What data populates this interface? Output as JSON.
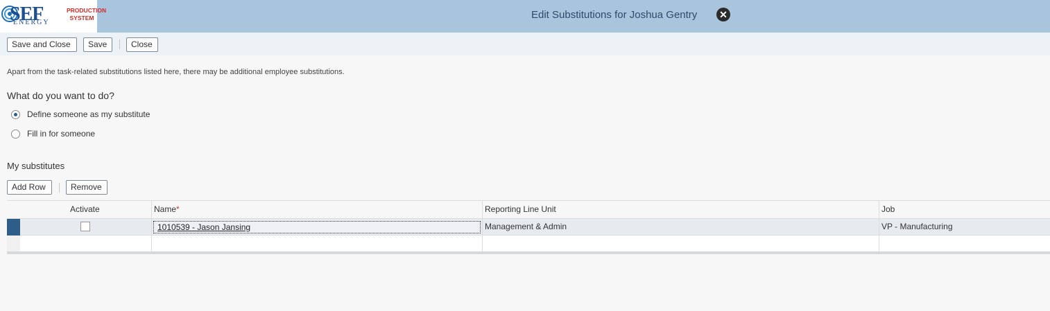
{
  "logo": {
    "mark": "SEF",
    "sub": "ENERGY",
    "line1": "PRODUCTION",
    "line2": "SYSTEM"
  },
  "header": {
    "title": "Edit Substitutions for Joshua Gentry",
    "close_icon": "close-circle-icon"
  },
  "toolbar": {
    "save_close_label": "Save and Close",
    "save_label": "Save",
    "close_label": "Close"
  },
  "info_text": "Apart from the task-related substitutions listed here, there may be additional employee substitutions.",
  "question": "What do you want to do?",
  "options": [
    {
      "label": "Define someone as my substitute",
      "selected": true
    },
    {
      "label": "Fill in for someone",
      "selected": false
    }
  ],
  "section_title": "My substitutes",
  "table_toolbar": {
    "add_row_label": "Add Row",
    "remove_label": "Remove"
  },
  "table": {
    "columns": [
      "Activate",
      "Name",
      "Reporting Line Unit",
      "Job"
    ],
    "required_marker": "*",
    "rows": [
      {
        "activate": false,
        "name": "1010539 - Jason Jansing",
        "reporting_line_unit": "Management & Admin",
        "job": "VP - Manufacturing"
      }
    ]
  },
  "colors": {
    "header_bg": "#a9c4dd",
    "toolbar_bg": "#edf2f6",
    "selected_row_marker": "#2f5d8a"
  }
}
